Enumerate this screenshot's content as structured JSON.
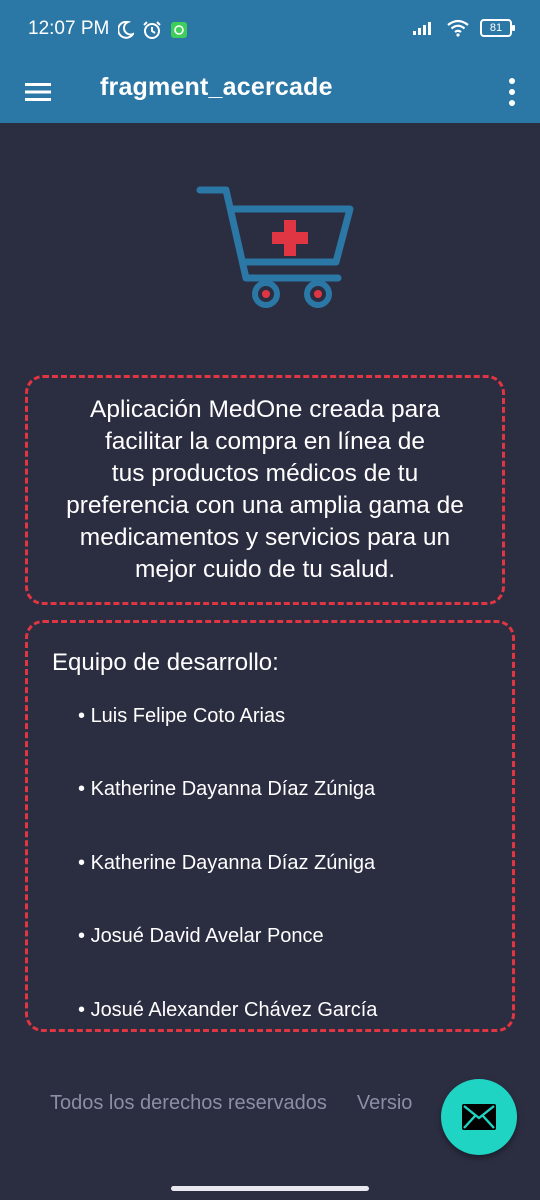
{
  "status_bar": {
    "time": "12:07 PM",
    "battery": "81",
    "icons": [
      "moon-icon",
      "alarm-icon",
      "app-notification-icon",
      "signal-icon",
      "wifi-icon",
      "battery-icon"
    ]
  },
  "app_bar": {
    "title": "fragment_acercade",
    "menu_icon": "hamburger-menu-icon",
    "overflow_icon": "more-vertical-icon",
    "color": "#2b77a5"
  },
  "logo": {
    "icon": "medical-cart-icon",
    "cart_color": "#2b77a5",
    "cross_color": "#e03543"
  },
  "description": {
    "lines": [
      "Aplicación MedOne creada para",
      "facilitar la compra en línea de",
      "tus productos médicos de tu",
      "preferencia con una amplia gama de",
      "medicamentos y servicios para un",
      "mejor cuido de tu salud."
    ]
  },
  "team": {
    "heading": "Equipo de desarrollo:",
    "members": [
      "Luis Felipe Coto Arias",
      "Katherine Dayanna Díaz Zúniga",
      "Katherine Dayanna Díaz Zúniga",
      "Josué David Avelar Ponce",
      "Josué Alexander Chávez García"
    ]
  },
  "footer": {
    "rights": "Todos los derechos reservados",
    "version": "Versio"
  },
  "fab": {
    "icon": "mail-icon",
    "color": "#1fd4c3"
  },
  "colors": {
    "background": "#2b2d41",
    "border_accent": "#e03543"
  }
}
